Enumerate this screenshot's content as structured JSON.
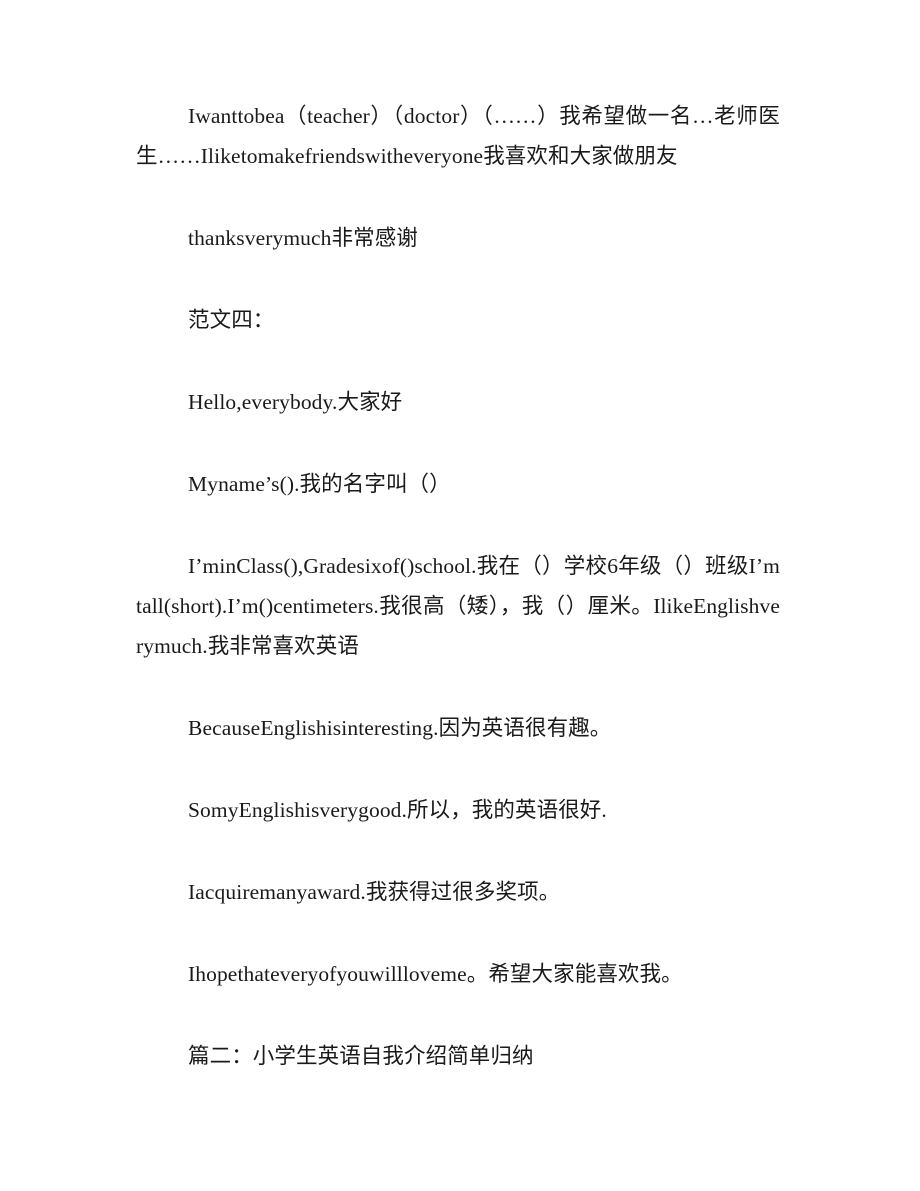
{
  "document": {
    "page_background": "#ffffff",
    "text_color": "#000000",
    "paragraphs": [
      {
        "id": "para-want-to-be",
        "text": "Iwanttobea（teacher）（doctor）（……）我希望做一名…老师医生……Iliketomakefriendswitheveryone我喜欢和大家做朋友"
      },
      {
        "id": "para-thanks",
        "text": "thanksverymuch非常感谢"
      },
      {
        "id": "para-sample-four-heading",
        "text": "范文四："
      },
      {
        "id": "para-hello",
        "text": "Hello,everybody.大家好"
      },
      {
        "id": "para-my-name",
        "text": "Myname’s().我的名字叫（）"
      },
      {
        "id": "para-class-grade",
        "text": "I’minClass(),Gradesixof()school.我在（）学校6年级（）班级I’mtall(short).I’m()centimeters.我很高（矮），我（）厘米。IlikeEnglishverymuch.我非常喜欢英语"
      },
      {
        "id": "para-because-interesting",
        "text": "BecauseEnglishisinteresting.因为英语很有趣。"
      },
      {
        "id": "para-so-my-english",
        "text": "SomyEnglishisverygood.所以，我的英语很好."
      },
      {
        "id": "para-award",
        "text": "Iacquiremanyaward.我获得过很多奖项。"
      },
      {
        "id": "para-hope-love-me",
        "text": "Ihopethateveryofyouwillloveme。希望大家能喜欢我。"
      },
      {
        "id": "para-section-two-heading",
        "text": "篇二：小学生英语自我介绍简单归纳"
      }
    ]
  }
}
